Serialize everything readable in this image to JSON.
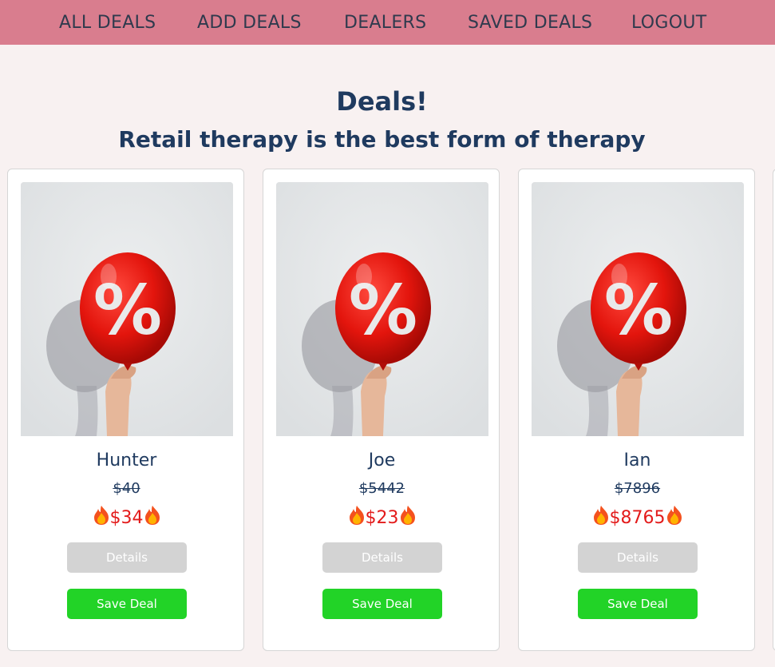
{
  "nav": {
    "items": [
      {
        "label": "ALL DEALS"
      },
      {
        "label": "ADD DEALS"
      },
      {
        "label": "DEALERS"
      },
      {
        "label": "SAVED DEALS"
      },
      {
        "label": "LOGOUT"
      }
    ]
  },
  "header": {
    "title": "Deals!",
    "subtitle": "Retail therapy is the best form of therapy"
  },
  "deals": [
    {
      "name": "Hunter",
      "original_price": "$40",
      "sale_price": "$34",
      "details_label": "Details",
      "save_label": "Save Deal"
    },
    {
      "name": "Joe",
      "original_price": "$5442",
      "sale_price": "$23",
      "details_label": "Details",
      "save_label": "Save Deal"
    },
    {
      "name": "Ian",
      "original_price": "$7896",
      "sale_price": "$8765",
      "details_label": "Details",
      "save_label": "Save Deal"
    }
  ],
  "icons": {
    "sale_marker": "fire-icon",
    "deal_image": "percent-balloon-image"
  },
  "colors": {
    "navbar": "#d97d8e",
    "page_background": "#f8f1f1",
    "heading": "#1f3a5f",
    "sale_price": "#e31b1b",
    "save_button": "#22d327",
    "details_button": "#d3d3d3"
  }
}
